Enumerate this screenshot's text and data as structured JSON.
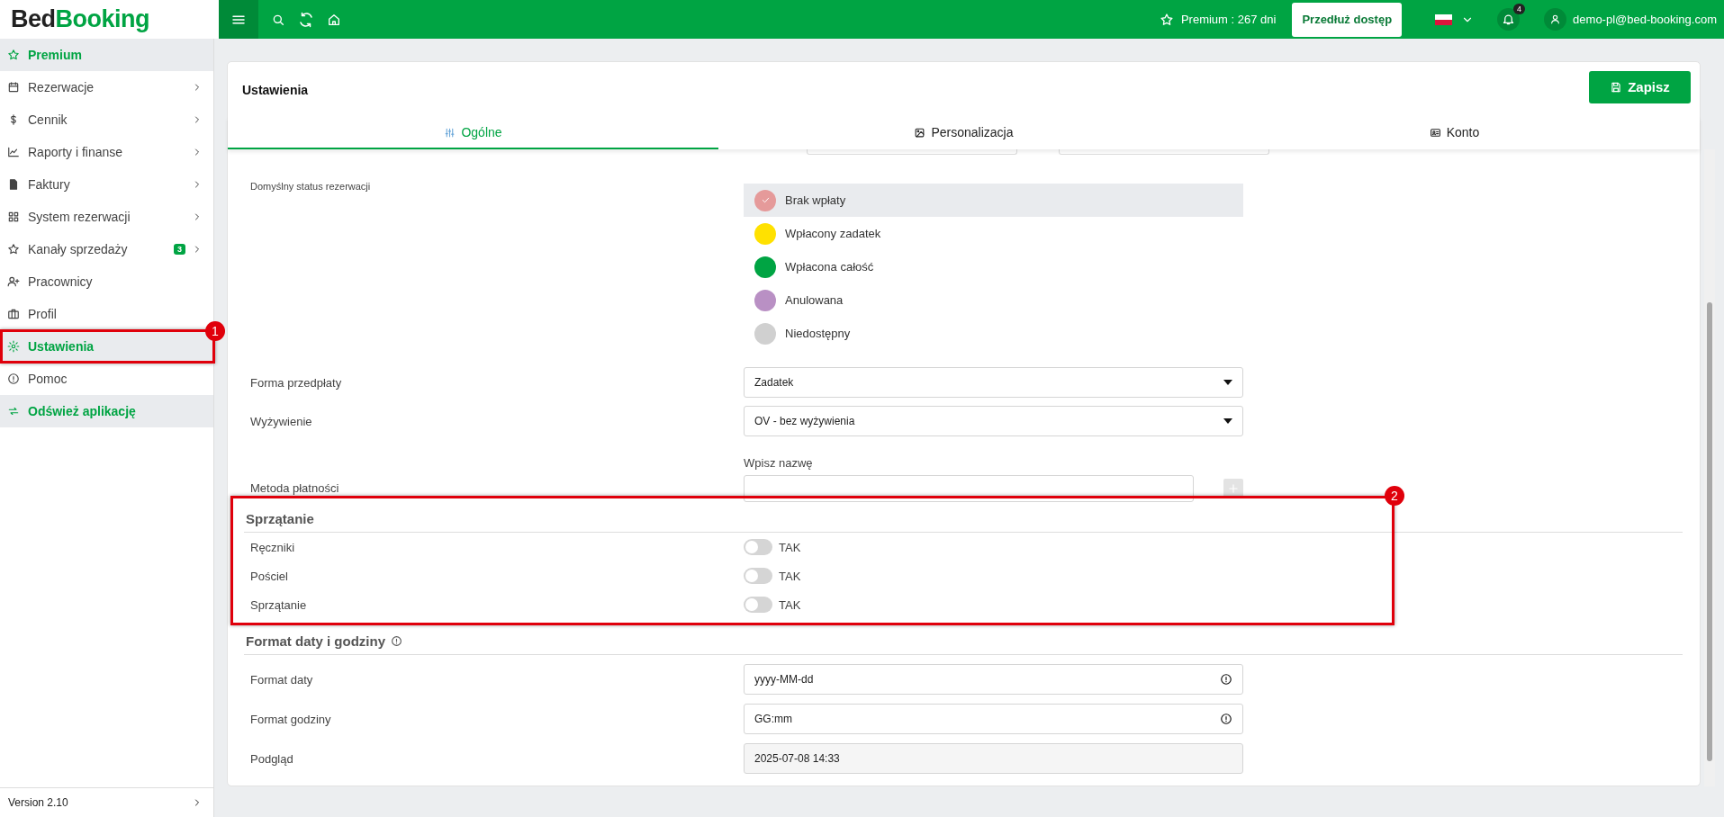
{
  "topbar": {
    "logo": [
      "Bed",
      "Booking"
    ],
    "premium": "Premium : 267 dni",
    "extend_button": "Przedłuż dostęp",
    "notifications_badge": "4",
    "user_email": "demo-pl@bed-booking.com"
  },
  "sidebar": {
    "items": [
      {
        "label": "Premium",
        "kind": "highlight",
        "selected": false,
        "expandable": false
      },
      {
        "label": "Rezerwacje",
        "kind": "link",
        "selected": false,
        "expandable": true
      },
      {
        "label": "Cennik",
        "kind": "link",
        "selected": false,
        "expandable": true
      },
      {
        "label": "Raporty i finanse",
        "kind": "link",
        "selected": false,
        "expandable": true
      },
      {
        "label": "Faktury",
        "kind": "link",
        "selected": false,
        "expandable": true
      },
      {
        "label": "System rezerwacji",
        "kind": "link",
        "selected": false,
        "expandable": true
      },
      {
        "label": "Kanały sprzedaży",
        "kind": "link",
        "selected": false,
        "expandable": true,
        "badge": "3"
      },
      {
        "label": "Pracownicy",
        "kind": "link",
        "selected": false,
        "expandable": false
      },
      {
        "label": "Profil",
        "kind": "link",
        "selected": false,
        "expandable": false
      },
      {
        "label": "Ustawienia",
        "kind": "link",
        "selected": true,
        "expandable": false,
        "annotation": "1"
      },
      {
        "label": "Pomoc",
        "kind": "link",
        "selected": false,
        "expandable": false
      },
      {
        "label": "Odśwież aplikację",
        "kind": "highlight",
        "selected": false,
        "expandable": false
      }
    ],
    "version": "Version 2.10"
  },
  "settings": {
    "title": "Ustawienia",
    "save_button": "Zapisz",
    "tabs": [
      {
        "label": "Ogólne",
        "selected": true
      },
      {
        "label": "Personalizacja",
        "selected": false
      },
      {
        "label": "Konto",
        "selected": false
      }
    ],
    "default_status": {
      "label": "Domyślny status rezerwacji",
      "options": [
        {
          "label": "Brak wpłaty",
          "color": "#e59a9a",
          "selected": true
        },
        {
          "label": "Wpłacony zadatek",
          "color": "#ffe100",
          "selected": false
        },
        {
          "label": "Wpłacona całość",
          "color": "#00a443",
          "selected": false
        },
        {
          "label": "Anulowana",
          "color": "#b990c4",
          "selected": false
        },
        {
          "label": "Niedostępny",
          "color": "#d0d0d0",
          "selected": false
        }
      ]
    },
    "prepayment": {
      "label": "Forma przedpłaty",
      "value": "Zadatek"
    },
    "board": {
      "label": "Wyżywienie",
      "value": "OV - bez wyżywienia"
    },
    "payment_method": {
      "label": "Metoda płatności",
      "field_label": "Wpisz nazwę"
    },
    "cleaning": {
      "heading": "Sprzątanie",
      "annotation": "2",
      "toggles": [
        {
          "label": "Ręczniki",
          "text": "TAK",
          "on": false
        },
        {
          "label": "Pościel",
          "text": "TAK",
          "on": false
        },
        {
          "label": "Sprzątanie",
          "text": "TAK",
          "on": false
        }
      ]
    },
    "datetime": {
      "heading": "Format daty i godziny",
      "fields": [
        {
          "label": "Format daty",
          "value": "yyyy-MM-dd",
          "kind": "input"
        },
        {
          "label": "Format godziny",
          "value": "GG:mm",
          "kind": "input"
        },
        {
          "label": "Podgląd",
          "value": "2025-07-08 14:33",
          "kind": "readonly"
        }
      ]
    }
  }
}
